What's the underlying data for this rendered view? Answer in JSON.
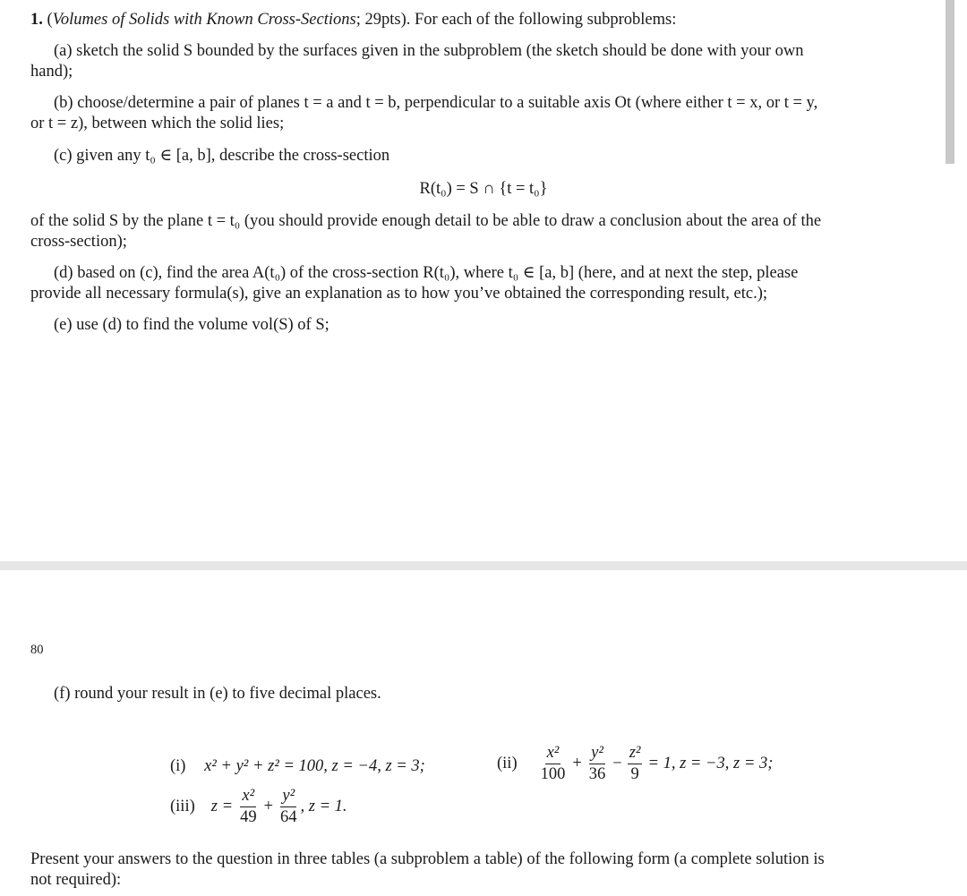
{
  "problem": {
    "number": "1.",
    "title": "Volumes of Solids with Known Cross-Sections",
    "points": "29pts",
    "intro": "For each of the following subproblems:"
  },
  "steps": {
    "a": {
      "label": "(a)",
      "line1": "sketch the solid S bounded by the surfaces given in the subproblem (the sketch should be done with your own",
      "line2": "hand);"
    },
    "b": {
      "label": "(b)",
      "line1": "choose/determine a pair of planes t = a and t = b, perpendicular to a suitable axis Ot (where either t = x, or t = y,",
      "line2": "or t = z), between which the solid lies;"
    },
    "c": {
      "label": "(c)",
      "line1": "given any t₀ ∈ [a, b], describe the cross-section",
      "display_formula": "R(t₀) = S ∩ {t = t₀}",
      "line2": "of the solid S by the plane t = t₀ (you should provide enough detail to be able to draw a conclusion about the area of the",
      "line3": "cross-section);"
    },
    "d": {
      "label": "(d)",
      "line1": "based on (c), find the area A(t₀) of the cross-section R(t₀), where t₀ ∈ [a, b] (here, and at next the step, please",
      "line2": "provide all necessary formula(s), give an explanation as to how you’ve obtained the corresponding result, etc.);"
    },
    "e": {
      "label": "(e)",
      "line1": "use (d) to find the volume vol(S) of S;"
    },
    "f": {
      "label": "(f)",
      "line1": "round your result in (e) to five decimal places."
    }
  },
  "page_number": "80",
  "subproblems": [
    {
      "label": "(i)",
      "equation": "x² + y² + z² = 100, z = −4, z = 3;"
    },
    {
      "label": "(ii)",
      "equation": "x²/100 + y²/36 − z²/9 = 1, z = −3, z = 3;",
      "terms": [
        {
          "num": "x²",
          "den": "100"
        },
        {
          "num": "y²",
          "den": "36"
        },
        {
          "num": "z²",
          "den": "9"
        }
      ],
      "tail": "= 1, z = −3, z = 3;"
    },
    {
      "label": "(iii)",
      "equation": "z = x²/49 + y²/64, z = 1.",
      "lead": "z =",
      "terms": [
        {
          "num": "x²",
          "den": "49"
        },
        {
          "num": "y²",
          "den": "64"
        }
      ],
      "tail": ", z = 1."
    }
  ],
  "closing": {
    "line1": "Present your answers to the question in three tables (a subproblem a table) of the following form (a complete solution is",
    "line2": "not required):"
  }
}
